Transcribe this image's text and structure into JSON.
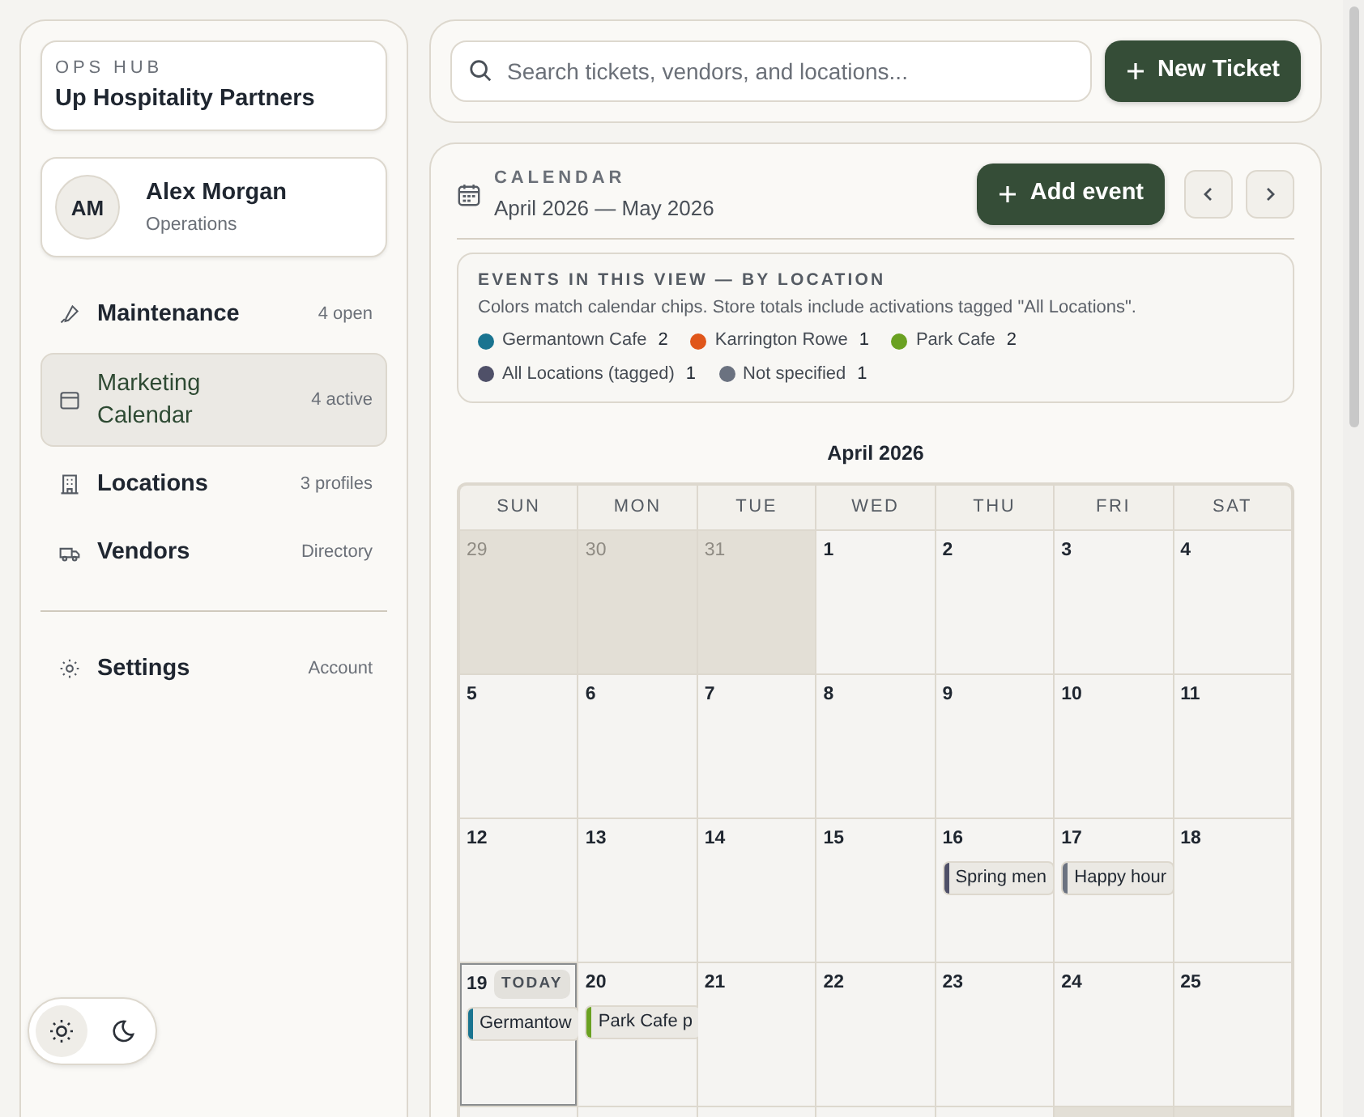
{
  "brand": {
    "eyebrow": "OPS HUB",
    "name": "Up Hospitality Partners"
  },
  "user": {
    "initials": "AM",
    "name": "Alex Morgan",
    "role": "Operations"
  },
  "nav": [
    {
      "label": "Maintenance",
      "meta": "4 open",
      "selected": false
    },
    {
      "label": "Marketing Calendar",
      "meta": "4 active",
      "selected": true
    },
    {
      "label": "Locations",
      "meta": "3 profiles",
      "selected": false
    },
    {
      "label": "Vendors",
      "meta": "Directory",
      "selected": false
    }
  ],
  "settings": {
    "label": "Settings",
    "meta": "Account",
    "selected": false
  },
  "theme": {
    "light_selected": true
  },
  "search": {
    "placeholder": "Search tickets, vendors, and locations..."
  },
  "new_ticket": "New Ticket",
  "calendar": {
    "eyebrow": "CALENDAR",
    "range": "April 2026 — May 2026",
    "add": "Add event",
    "legend": {
      "title": "EVENTS IN THIS VIEW — BY LOCATION",
      "note": "Colors match calendar chips. Store totals include activations tagged \"All Locations\".",
      "items": [
        {
          "name": "Germantown Cafe",
          "count": "2",
          "color": "#1a7490"
        },
        {
          "name": "Karrington Rowe",
          "count": "1",
          "color": "#e0561a"
        },
        {
          "name": "Park Cafe",
          "count": "2",
          "color": "#6aa121"
        },
        {
          "name": "All Locations (tagged)",
          "count": "1",
          "color": "#4f5068"
        },
        {
          "name": "Not specified",
          "count": "1",
          "color": "#6b7280"
        }
      ]
    },
    "month": "April 2026",
    "weekdays": [
      "SUN",
      "MON",
      "TUE",
      "WED",
      "THU",
      "FRI",
      "SAT"
    ],
    "weeks": [
      [
        {
          "day": "29",
          "in_month": false
        },
        {
          "day": "30",
          "in_month": false
        },
        {
          "day": "31",
          "in_month": false
        },
        {
          "day": "1",
          "in_month": true
        },
        {
          "day": "2",
          "in_month": true
        },
        {
          "day": "3",
          "in_month": true
        },
        {
          "day": "4",
          "in_month": true
        }
      ],
      [
        {
          "day": "5",
          "in_month": true
        },
        {
          "day": "6",
          "in_month": true
        },
        {
          "day": "7",
          "in_month": true
        },
        {
          "day": "8",
          "in_month": true
        },
        {
          "day": "9",
          "in_month": true
        },
        {
          "day": "10",
          "in_month": true
        },
        {
          "day": "11",
          "in_month": true
        }
      ],
      [
        {
          "day": "12",
          "in_month": true
        },
        {
          "day": "13",
          "in_month": true
        },
        {
          "day": "14",
          "in_month": true
        },
        {
          "day": "15",
          "in_month": true
        },
        {
          "day": "16",
          "in_month": true,
          "events": [
            {
              "title": "Spring men",
              "color": "#4f5068"
            }
          ]
        },
        {
          "day": "17",
          "in_month": true,
          "events": [
            {
              "title": "Happy hour",
              "color": "#6b7280"
            }
          ]
        },
        {
          "day": "18",
          "in_month": true
        }
      ],
      [
        {
          "day": "19",
          "in_month": true,
          "today": true,
          "today_label": "TODAY",
          "events": [
            {
              "title": "Germantow",
              "color": "#1a7490"
            }
          ]
        },
        {
          "day": "20",
          "in_month": true,
          "events": [
            {
              "title": "Park Cafe p",
              "color": "#6aa121"
            }
          ]
        },
        {
          "day": "21",
          "in_month": true
        },
        {
          "day": "22",
          "in_month": true
        },
        {
          "day": "23",
          "in_month": true
        },
        {
          "day": "24",
          "in_month": true
        },
        {
          "day": "25",
          "in_month": true
        }
      ],
      [
        {
          "in_month": true
        },
        {
          "in_month": true
        },
        {
          "in_month": true
        },
        {
          "in_month": true
        },
        {
          "in_month": true
        },
        {
          "in_month": false
        },
        {
          "in_month": false
        }
      ]
    ]
  }
}
